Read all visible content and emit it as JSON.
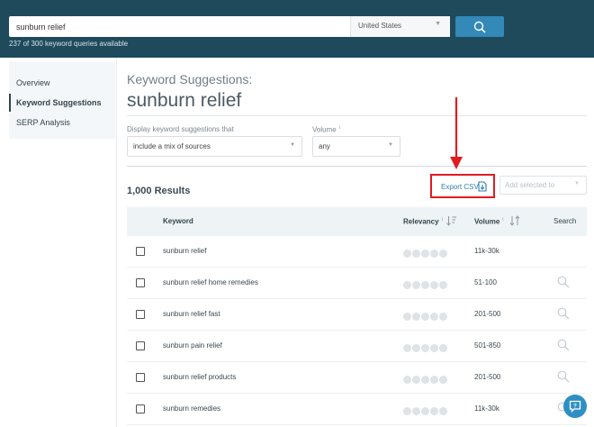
{
  "header": {
    "search_value": "sunburn relief",
    "country": "United States",
    "quota_text": "237 of 300 keyword queries available"
  },
  "sidebar": {
    "items": [
      {
        "label": "Overview",
        "active": false
      },
      {
        "label": "Keyword Suggestions",
        "active": true
      },
      {
        "label": "SERP Analysis",
        "active": false
      }
    ]
  },
  "main": {
    "heading_small": "Keyword Suggestions:",
    "heading_big": "sunburn relief",
    "filter_label": "Display keyword suggestions that",
    "filter_value": "include a mix of sources",
    "volume_label": "Volume",
    "volume_value": "any",
    "info_mark": "i",
    "results_count": "1,000 Results",
    "export_label": "Export CSV",
    "add_selected_placeholder": "Add selected to"
  },
  "table": {
    "headers": {
      "keyword": "Keyword",
      "relevancy": "Relevancy",
      "volume": "Volume",
      "search": "Search"
    },
    "rows": [
      {
        "keyword": "sunburn relief",
        "volume": "11k-30k",
        "search_icon": false
      },
      {
        "keyword": "sunburn relief home remedies",
        "volume": "51-100",
        "search_icon": true
      },
      {
        "keyword": "sunburn relief fast",
        "volume": "201-500",
        "search_icon": true
      },
      {
        "keyword": "sunburn pain relief",
        "volume": "501-850",
        "search_icon": true
      },
      {
        "keyword": "sunburn relief products",
        "volume": "201-500",
        "search_icon": true
      },
      {
        "keyword": "sunburn remedies",
        "volume": "11k-30k",
        "search_icon": true
      }
    ]
  },
  "colors": {
    "header_bg": "#1e4a5c",
    "accent_blue": "#3389b8",
    "highlight_red": "#e11b22"
  }
}
